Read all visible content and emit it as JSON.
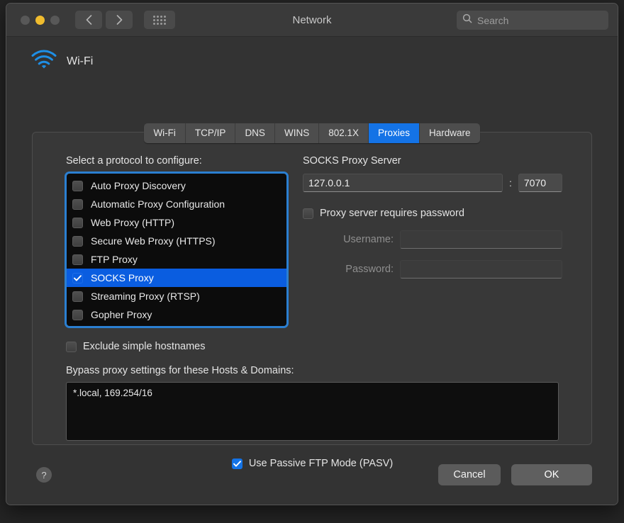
{
  "window": {
    "title": "Network",
    "traffic_lights": [
      "close",
      "minimize",
      "maximize"
    ],
    "nav_back_icon": "chevron-left-icon",
    "nav_forward_icon": "chevron-right-icon",
    "grid_icon": "show-all-icon"
  },
  "search": {
    "placeholder": "Search",
    "icon": "search-icon"
  },
  "interface": {
    "name": "Wi-Fi",
    "icon": "wifi-icon",
    "icon_color": "#1e8fe6"
  },
  "tabs": [
    {
      "label": "Wi-Fi",
      "active": false
    },
    {
      "label": "TCP/IP",
      "active": false
    },
    {
      "label": "DNS",
      "active": false
    },
    {
      "label": "WINS",
      "active": false
    },
    {
      "label": "802.1X",
      "active": false
    },
    {
      "label": "Proxies",
      "active": true
    },
    {
      "label": "Hardware",
      "active": false
    }
  ],
  "protocols": {
    "label": "Select a protocol to configure:",
    "items": [
      {
        "label": "Auto Proxy Discovery",
        "checked": false,
        "selected": false
      },
      {
        "label": "Automatic Proxy Configuration",
        "checked": false,
        "selected": false
      },
      {
        "label": "Web Proxy (HTTP)",
        "checked": false,
        "selected": false
      },
      {
        "label": "Secure Web Proxy (HTTPS)",
        "checked": false,
        "selected": false
      },
      {
        "label": "FTP Proxy",
        "checked": false,
        "selected": false
      },
      {
        "label": "SOCKS Proxy",
        "checked": true,
        "selected": true
      },
      {
        "label": "Streaming Proxy (RTSP)",
        "checked": false,
        "selected": false
      },
      {
        "label": "Gopher Proxy",
        "checked": false,
        "selected": false
      }
    ]
  },
  "proxy_server": {
    "title": "SOCKS Proxy Server",
    "host": "127.0.0.1",
    "separator": ":",
    "port": "7070",
    "requires_password_label": "Proxy server requires password",
    "requires_password_checked": false,
    "username_label": "Username:",
    "username_value": "",
    "password_label": "Password:",
    "password_value": ""
  },
  "bypass": {
    "exclude_simple_label": "Exclude simple hostnames",
    "exclude_simple_checked": false,
    "list_label": "Bypass proxy settings for these Hosts & Domains:",
    "list_value": "*.local, 169.254/16"
  },
  "pasv": {
    "label": "Use Passive FTP Mode (PASV)",
    "checked": true
  },
  "footer": {
    "help_label": "?",
    "cancel_label": "Cancel",
    "ok_label": "OK"
  },
  "colors": {
    "accent_blue": "#1473e6",
    "selection_blue": "#0a5de0",
    "focus_ring": "#2b7fd1",
    "minimize_yellow": "#f0bc2e"
  }
}
